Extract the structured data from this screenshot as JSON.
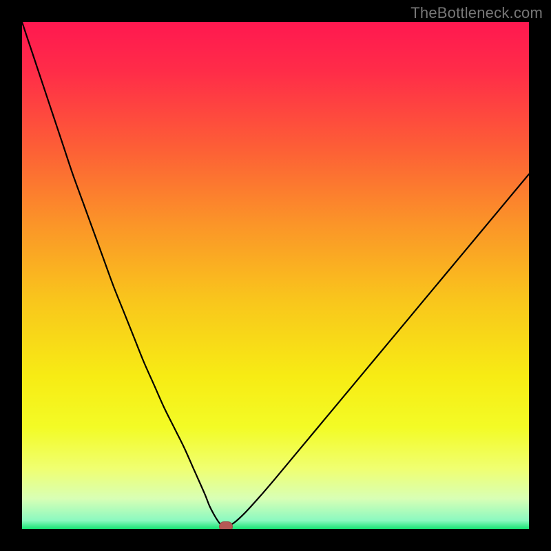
{
  "watermark": "TheBottleneck.com",
  "colors": {
    "black": "#000000",
    "gradient_stops": [
      {
        "offset": 0.0,
        "color": "#ff1850"
      },
      {
        "offset": 0.1,
        "color": "#ff2d48"
      },
      {
        "offset": 0.25,
        "color": "#fd5f36"
      },
      {
        "offset": 0.4,
        "color": "#fb9528"
      },
      {
        "offset": 0.55,
        "color": "#f9c61c"
      },
      {
        "offset": 0.7,
        "color": "#f7ec14"
      },
      {
        "offset": 0.8,
        "color": "#f3fb26"
      },
      {
        "offset": 0.88,
        "color": "#f0ff70"
      },
      {
        "offset": 0.94,
        "color": "#d8ffb5"
      },
      {
        "offset": 0.983,
        "color": "#8cf9c0"
      },
      {
        "offset": 1.0,
        "color": "#18e374"
      }
    ],
    "curve": "#000000",
    "marker": "#b55855"
  },
  "chart_data": {
    "type": "line",
    "title": "",
    "xlabel": "",
    "ylabel": "",
    "xlim": [
      0,
      100
    ],
    "ylim": [
      0,
      100
    ],
    "x": [
      0,
      2,
      4,
      6,
      8,
      10,
      12,
      14,
      16,
      18,
      20,
      22,
      24,
      26,
      28,
      30,
      32,
      34,
      36,
      37,
      38,
      38.5,
      39,
      39.7,
      40.5,
      41.8,
      44,
      47,
      50,
      54,
      58,
      62,
      66,
      70,
      74,
      78,
      82,
      86,
      90,
      94,
      98,
      100
    ],
    "values": [
      100,
      94,
      88,
      82,
      76,
      70,
      64.5,
      59,
      53.5,
      48,
      43,
      38,
      33,
      28.5,
      24,
      20,
      16,
      11.5,
      7,
      4.5,
      2.6,
      1.8,
      1.1,
      0.6,
      0.6,
      1.2,
      3.2,
      6.5,
      10.0,
      14.8,
      19.6,
      24.4,
      29.2,
      34.0,
      38.8,
      43.6,
      48.4,
      53.2,
      58.0,
      62.8,
      67.6,
      70.0
    ],
    "marker": {
      "x": 40.2,
      "y": 0.5,
      "w": 2.8,
      "h": 2.0
    },
    "grid": false,
    "legend": false
  }
}
